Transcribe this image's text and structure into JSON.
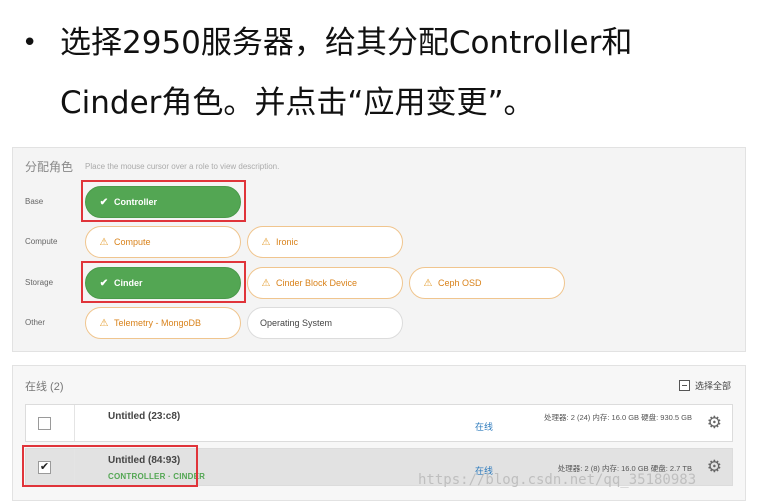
{
  "slide": {
    "bullet": "•",
    "line1": "选择2950服务器，给其分配Controller和",
    "line2": "Cinder角色。并点击“应用变更”。"
  },
  "roles_panel": {
    "title": "分配角色",
    "hint": "Place the mouse cursor over a role to view description.",
    "rows": {
      "base": "Base",
      "compute": "Compute",
      "storage": "Storage",
      "other": "Other"
    },
    "roles": {
      "controller": "Controller",
      "compute": "Compute",
      "ironic": "Ironic",
      "cinder": "Cinder",
      "cinder_block_device": "Cinder Block Device",
      "ceph_osd": "Ceph OSD",
      "telemetry_mongodb": "Telemetry - MongoDB",
      "operating_system": "Operating System"
    },
    "icons": {
      "selected": "check-icon",
      "warning": "warning-icon"
    },
    "colors": {
      "selected": "#53a653",
      "warning": "#e39a2a",
      "highlight": "#e0343a"
    }
  },
  "nodes_panel": {
    "title": "在线 (2)",
    "select_all": "选择全部",
    "nodes": [
      {
        "name": "Untitled (23:c8)",
        "status": "在线",
        "specs": "处理器: 2 (24) 内存: 16.0 GB 硬盘: 930.5 GB",
        "checked": false
      },
      {
        "name": "Untitled (84:93)",
        "roles": "CONTROLLER · CINDER",
        "status": "在线",
        "specs": "处理器: 2 (8) 内存: 16.0 GB 硬盘: 2.7 TB",
        "checked": true
      }
    ]
  },
  "watermark": "https://blog.csdn.net/qq_35180983"
}
